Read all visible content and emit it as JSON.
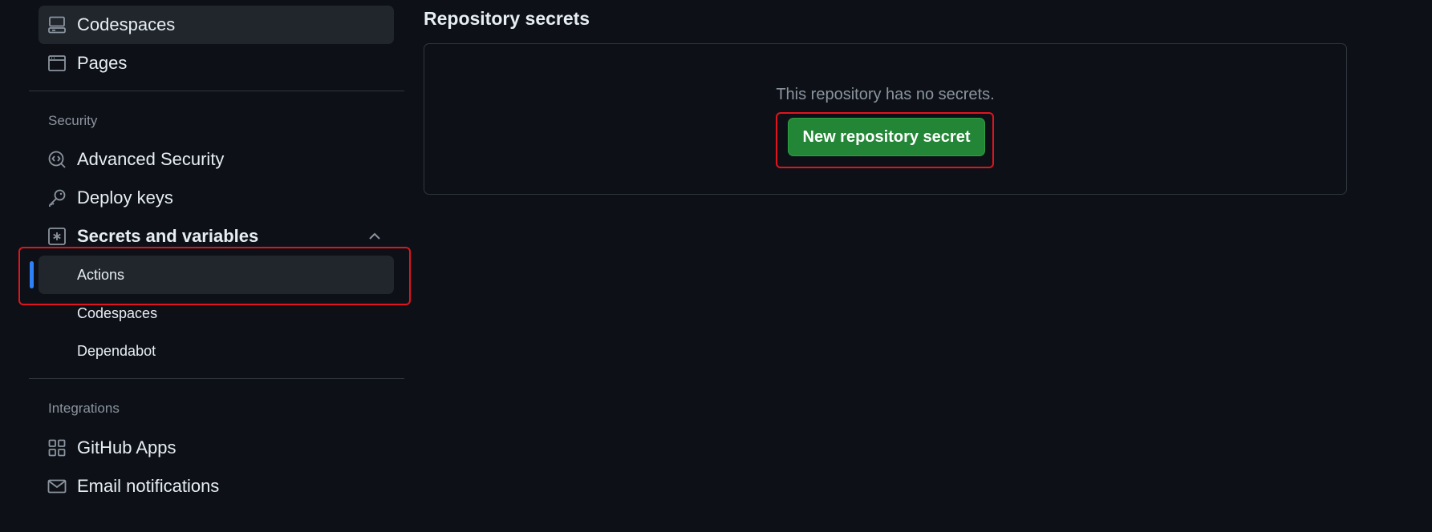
{
  "sidebar": {
    "items_top": [
      {
        "label": "Codespaces",
        "icon": "codespaces-icon"
      },
      {
        "label": "Pages",
        "icon": "browser-icon"
      }
    ],
    "security": {
      "heading": "Security",
      "items": [
        {
          "label": "Advanced Security",
          "icon": "codescan-icon"
        },
        {
          "label": "Deploy keys",
          "icon": "key-icon"
        },
        {
          "label": "Secrets and variables",
          "icon": "asterisk-icon"
        }
      ],
      "sub_items": [
        {
          "label": "Actions"
        },
        {
          "label": "Codespaces"
        },
        {
          "label": "Dependabot"
        }
      ]
    },
    "integrations": {
      "heading": "Integrations",
      "items": [
        {
          "label": "GitHub Apps",
          "icon": "apps-icon"
        },
        {
          "label": "Email notifications",
          "icon": "mail-icon"
        }
      ]
    }
  },
  "main": {
    "title": "Repository secrets",
    "empty_message": "This repository has no secrets.",
    "new_secret_button": "New repository secret"
  },
  "colors": {
    "background": "#0d1117",
    "active_item": "#21262d",
    "accent_blue": "#2f81f7",
    "primary_button": "#238636",
    "highlight_red": "#e0141e"
  }
}
